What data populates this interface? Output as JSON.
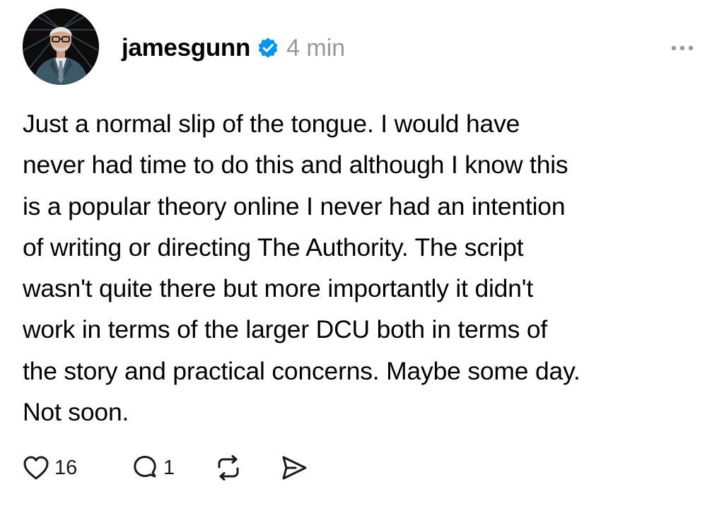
{
  "post": {
    "username": "jamesgunn",
    "verified": true,
    "timestamp": "4 min",
    "text_lines": [
      "Just a normal slip of the tongue. I would have",
      "never had time to do this and although I know this",
      "is a popular theory online I never had an intention",
      "of writing or directing The Authority. The script",
      "wasn't quite there but more importantly it didn't",
      "work in terms of the larger DCU both in terms of",
      "the story and practical concerns. Maybe some day.",
      "Not soon."
    ],
    "likes": "16",
    "replies": "1"
  },
  "icons": {
    "more": "more-horizontal-icon",
    "verified": "verified-badge-icon",
    "like": "heart-icon",
    "reply": "comment-icon",
    "repost": "repost-icon",
    "share": "send-icon"
  },
  "colors": {
    "verified_blue": "#0095f6",
    "timestamp_gray": "#999999",
    "icon_dark": "#1a1a1a"
  }
}
